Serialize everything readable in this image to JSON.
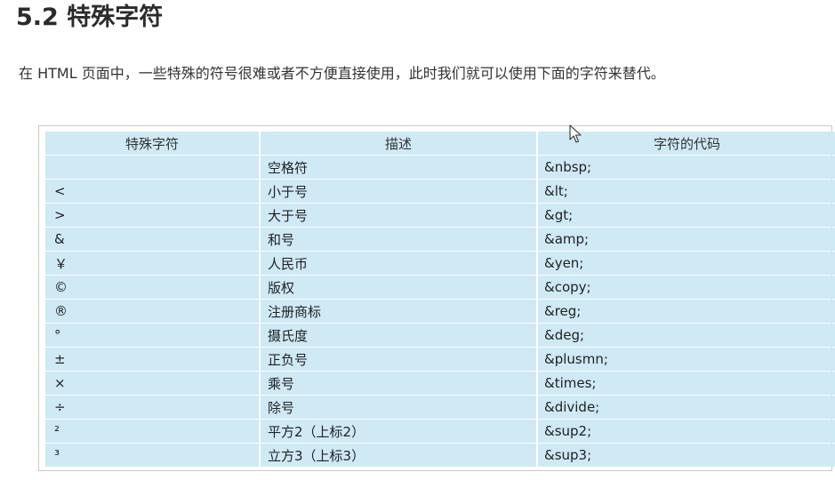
{
  "heading": "5.2 特殊字符",
  "intro": "在 HTML 页面中，一些特殊的符号很难或者不方便直接使用，此时我们就可以使用下面的字符来替代。",
  "table": {
    "headers": [
      "特殊字符",
      "描述",
      "字符的代码"
    ],
    "rows": [
      {
        "symbol": "",
        "description": "空格符",
        "code": "&nbsp;"
      },
      {
        "symbol": "<",
        "description": "小于号",
        "code": "&lt;"
      },
      {
        "symbol": ">",
        "description": "大于号",
        "code": "&gt;"
      },
      {
        "symbol": "&",
        "description": "和号",
        "code": "&amp;"
      },
      {
        "symbol": "￥",
        "description": "人民币",
        "code": "&yen;"
      },
      {
        "symbol": "©",
        "description": "版权",
        "code": "&copy;"
      },
      {
        "symbol": "®",
        "description": "注册商标",
        "code": "&reg;"
      },
      {
        "symbol": "°",
        "description": "摄氏度",
        "code": "&deg;"
      },
      {
        "symbol": "±",
        "description": "正负号",
        "code": "&plusmn;"
      },
      {
        "symbol": "×",
        "description": "乘号",
        "code": "&times;"
      },
      {
        "symbol": "÷",
        "description": "除号",
        "code": "&divide;"
      },
      {
        "symbol": "²",
        "description": "平方2（上标2）",
        "code": "&sup2;"
      },
      {
        "symbol": "³",
        "description": "立方3（上标3）",
        "code": "&sup3;"
      }
    ]
  },
  "cursor_icon": "mouse-pointer-icon"
}
